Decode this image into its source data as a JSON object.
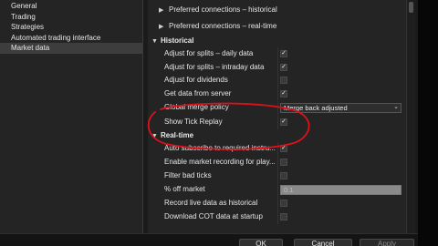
{
  "nav": {
    "items": [
      "General",
      "Trading",
      "Strategies",
      "Automated trading interface",
      "Market data"
    ],
    "selected_index": 4
  },
  "collapsed_sections": [
    {
      "label": "Preferred connections – historical"
    },
    {
      "label": "Preferred connections – real-time"
    }
  ],
  "historical": {
    "title": "Historical",
    "props": [
      {
        "label": "Adjust for splits – daily data",
        "checked": true
      },
      {
        "label": "Adjust for splits – intraday data",
        "checked": true
      },
      {
        "label": "Adjust for dividends",
        "checked": false
      },
      {
        "label": "Get data from server",
        "checked": true
      }
    ],
    "merge_policy": {
      "label": "Global merge policy",
      "value": "Merge back adjusted"
    },
    "tick_replay": {
      "label": "Show Tick Replay",
      "checked": true
    }
  },
  "realtime": {
    "title": "Real-time",
    "props": [
      {
        "label": "Auto subscribe to required instru...",
        "checked": true
      },
      {
        "label": "Enable market recording for play...",
        "checked": false
      },
      {
        "label": "Filter bad ticks",
        "checked": false
      }
    ],
    "off_market": {
      "label": "% off market",
      "value": "0.1"
    },
    "props2": [
      {
        "label": "Record live data as historical",
        "checked": false
      },
      {
        "label": "Download COT data at startup",
        "checked": false
      }
    ]
  },
  "buttons": {
    "ok": "OK",
    "cancel": "Cancel",
    "apply": "Apply"
  },
  "icons": {
    "collapsed": "chevron-right-icon",
    "expanded": "chevron-down-icon",
    "check": "check-icon",
    "dropdown": "chevron-down-icon"
  },
  "colors": {
    "background": "#1b1b1b",
    "panel": "#242424",
    "annotation": "#e0101a",
    "selected": "#3d3d3d"
  }
}
